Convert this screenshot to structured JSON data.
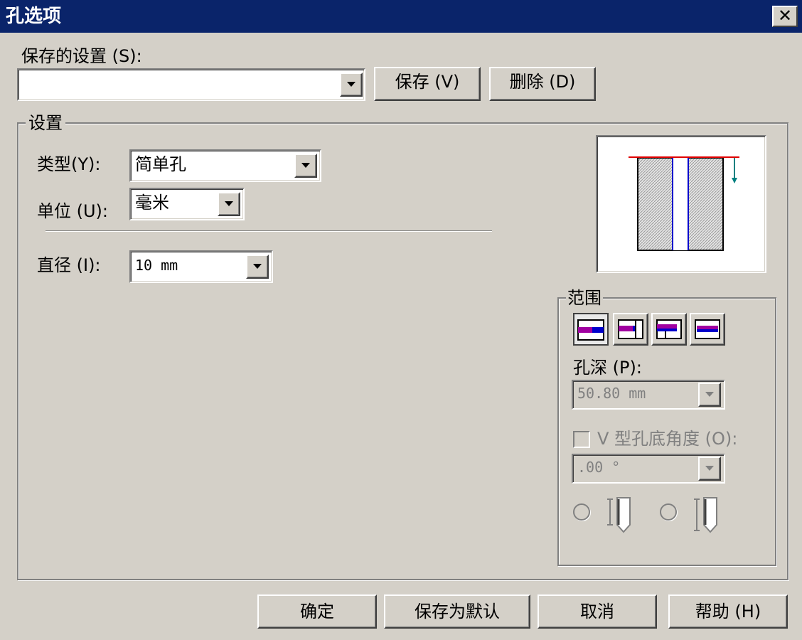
{
  "window": {
    "title": "孔选项",
    "close_glyph": "✕"
  },
  "saved_settings": {
    "label": "保存的设置 (S):",
    "value": "",
    "save_button": "保存 (V)",
    "delete_button": "删除 (D)"
  },
  "settings": {
    "group_title": "设置",
    "type_label": "类型(Y):",
    "type_value": "简单孔",
    "unit_label": "单位 (U):",
    "unit_value": "毫米",
    "diameter_label": "直径 (I):",
    "diameter_value": "10 mm"
  },
  "extent": {
    "group_title": "范围",
    "buttons": [
      "blind-extent-icon",
      "through-next-icon",
      "up-to-face-icon",
      "through-all-icon"
    ],
    "depth_label": "孔深 (P):",
    "depth_value": "50.80 mm",
    "v_angle_label": "V 型孔底角度 (O):",
    "v_angle_checked": false,
    "angle_value": ".00 °",
    "depth_reference_options": [
      "shoulder-depth-icon",
      "tip-depth-icon"
    ]
  },
  "footer": {
    "ok": "确定",
    "save_default": "保存为默认",
    "cancel": "取消",
    "help": "帮助 (H)"
  },
  "colors": {
    "titlebar": "#0a246a",
    "dialog_bg": "#d4d0c8",
    "preview_red": "#e00000",
    "preview_blue": "#0000cc",
    "preview_teal": "#008080",
    "extent_magenta": "#a000a0"
  }
}
